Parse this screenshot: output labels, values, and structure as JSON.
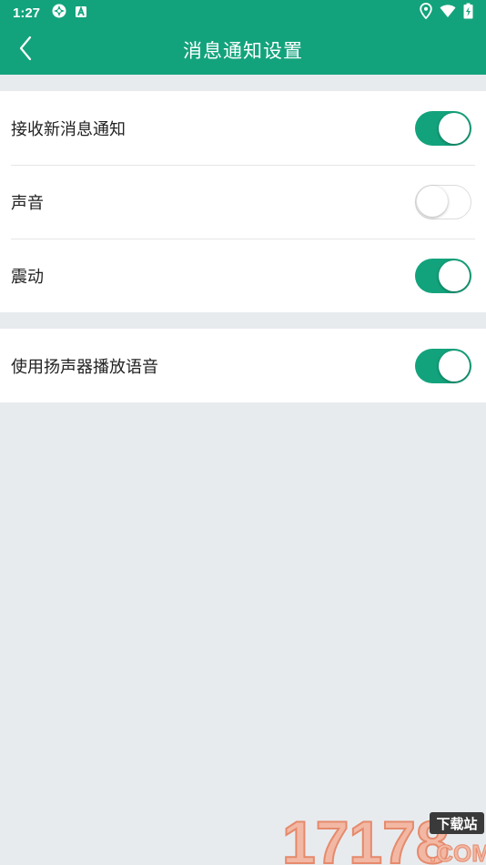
{
  "status_bar": {
    "time": "1:27",
    "left_icons": [
      "location-sync-icon",
      "a-badge-icon"
    ],
    "right_icons": [
      "location-pin-icon",
      "wifi-icon",
      "battery-charging-icon"
    ]
  },
  "app_bar": {
    "title": "消息通知设置",
    "back_icon": "chevron-left-icon"
  },
  "settings": {
    "group1": [
      {
        "label": "接收新消息通知",
        "enabled": true
      },
      {
        "label": "声音",
        "enabled": false
      },
      {
        "label": "震动",
        "enabled": true
      }
    ],
    "group2": [
      {
        "label": "使用扬声器播放语音",
        "enabled": true
      }
    ]
  },
  "watermark": {
    "number": "17178",
    "badge": "下载站",
    "suffix": ".COM"
  },
  "colors": {
    "accent": "#13a37c",
    "background": "#e8ebee",
    "toggle_off_border": "#dcdcdc"
  }
}
